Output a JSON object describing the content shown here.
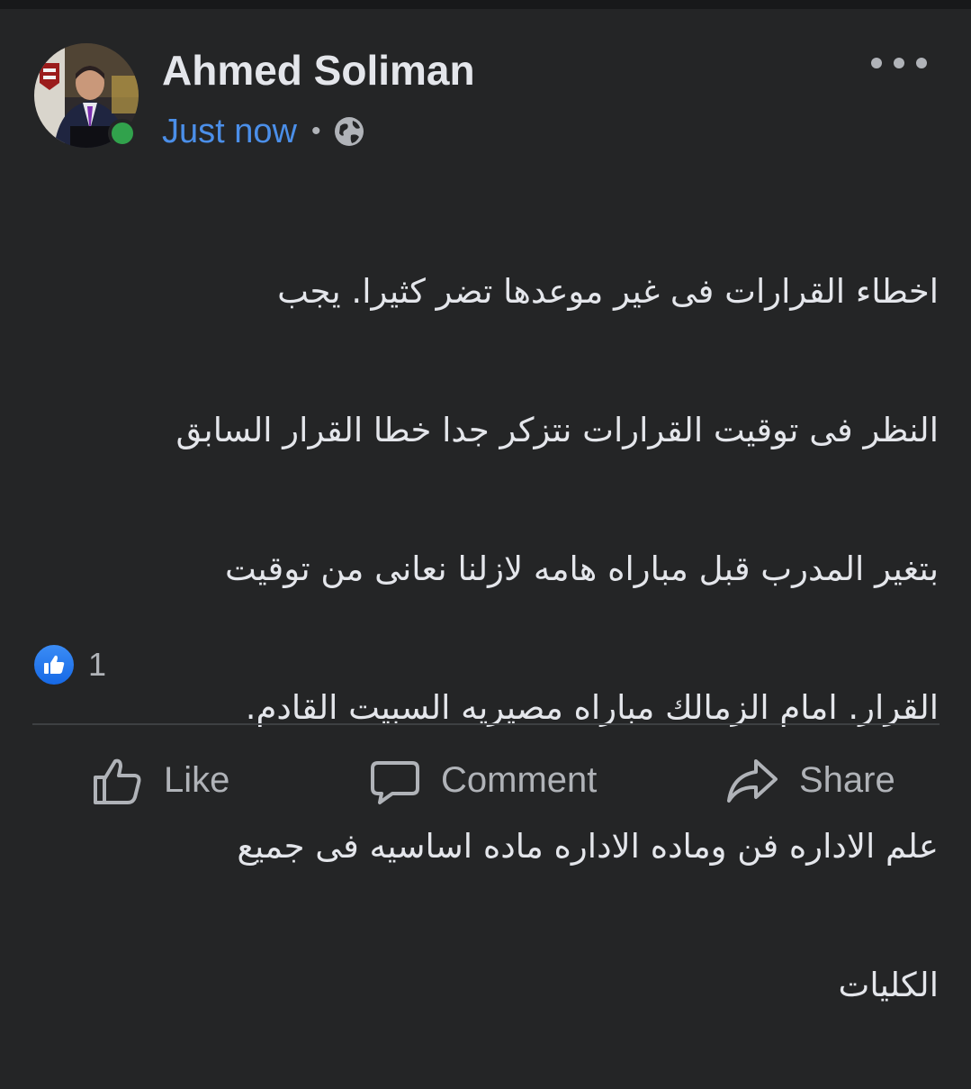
{
  "post": {
    "author": "Ahmed Soliman",
    "time": "Just now",
    "separator": "•",
    "privacy_icon": "globe-icon",
    "more_icon": "more-horizontal-icon",
    "text_lines": [
      "اخطاء القرارات فى غير موعدها تضر كثيرا. يجب",
      "النظر فى توقيت القرارات نتزكر جدا خطا القرار السابق",
      "بتغير المدرب قبل مباراه هامه لازلنا نعانى من توقيت",
      "القرار.       امام الزمالك مباراه مصيريه السبيت القادم.",
      "علم الاداره فن وماده الاداره ماده اساسيه فى جميع",
      "الكليات"
    ]
  },
  "reactions": {
    "icon": "like-reaction-icon",
    "count": "1"
  },
  "actions": {
    "like_label": "Like",
    "comment_label": "Comment",
    "share_label": "Share"
  },
  "colors": {
    "background": "#242526",
    "text": "#e4e6eb",
    "secondary": "#b0b3b8",
    "link_blue": "#4b8fe9",
    "online_green": "#31a24c",
    "like_blue": "#1877f2"
  }
}
